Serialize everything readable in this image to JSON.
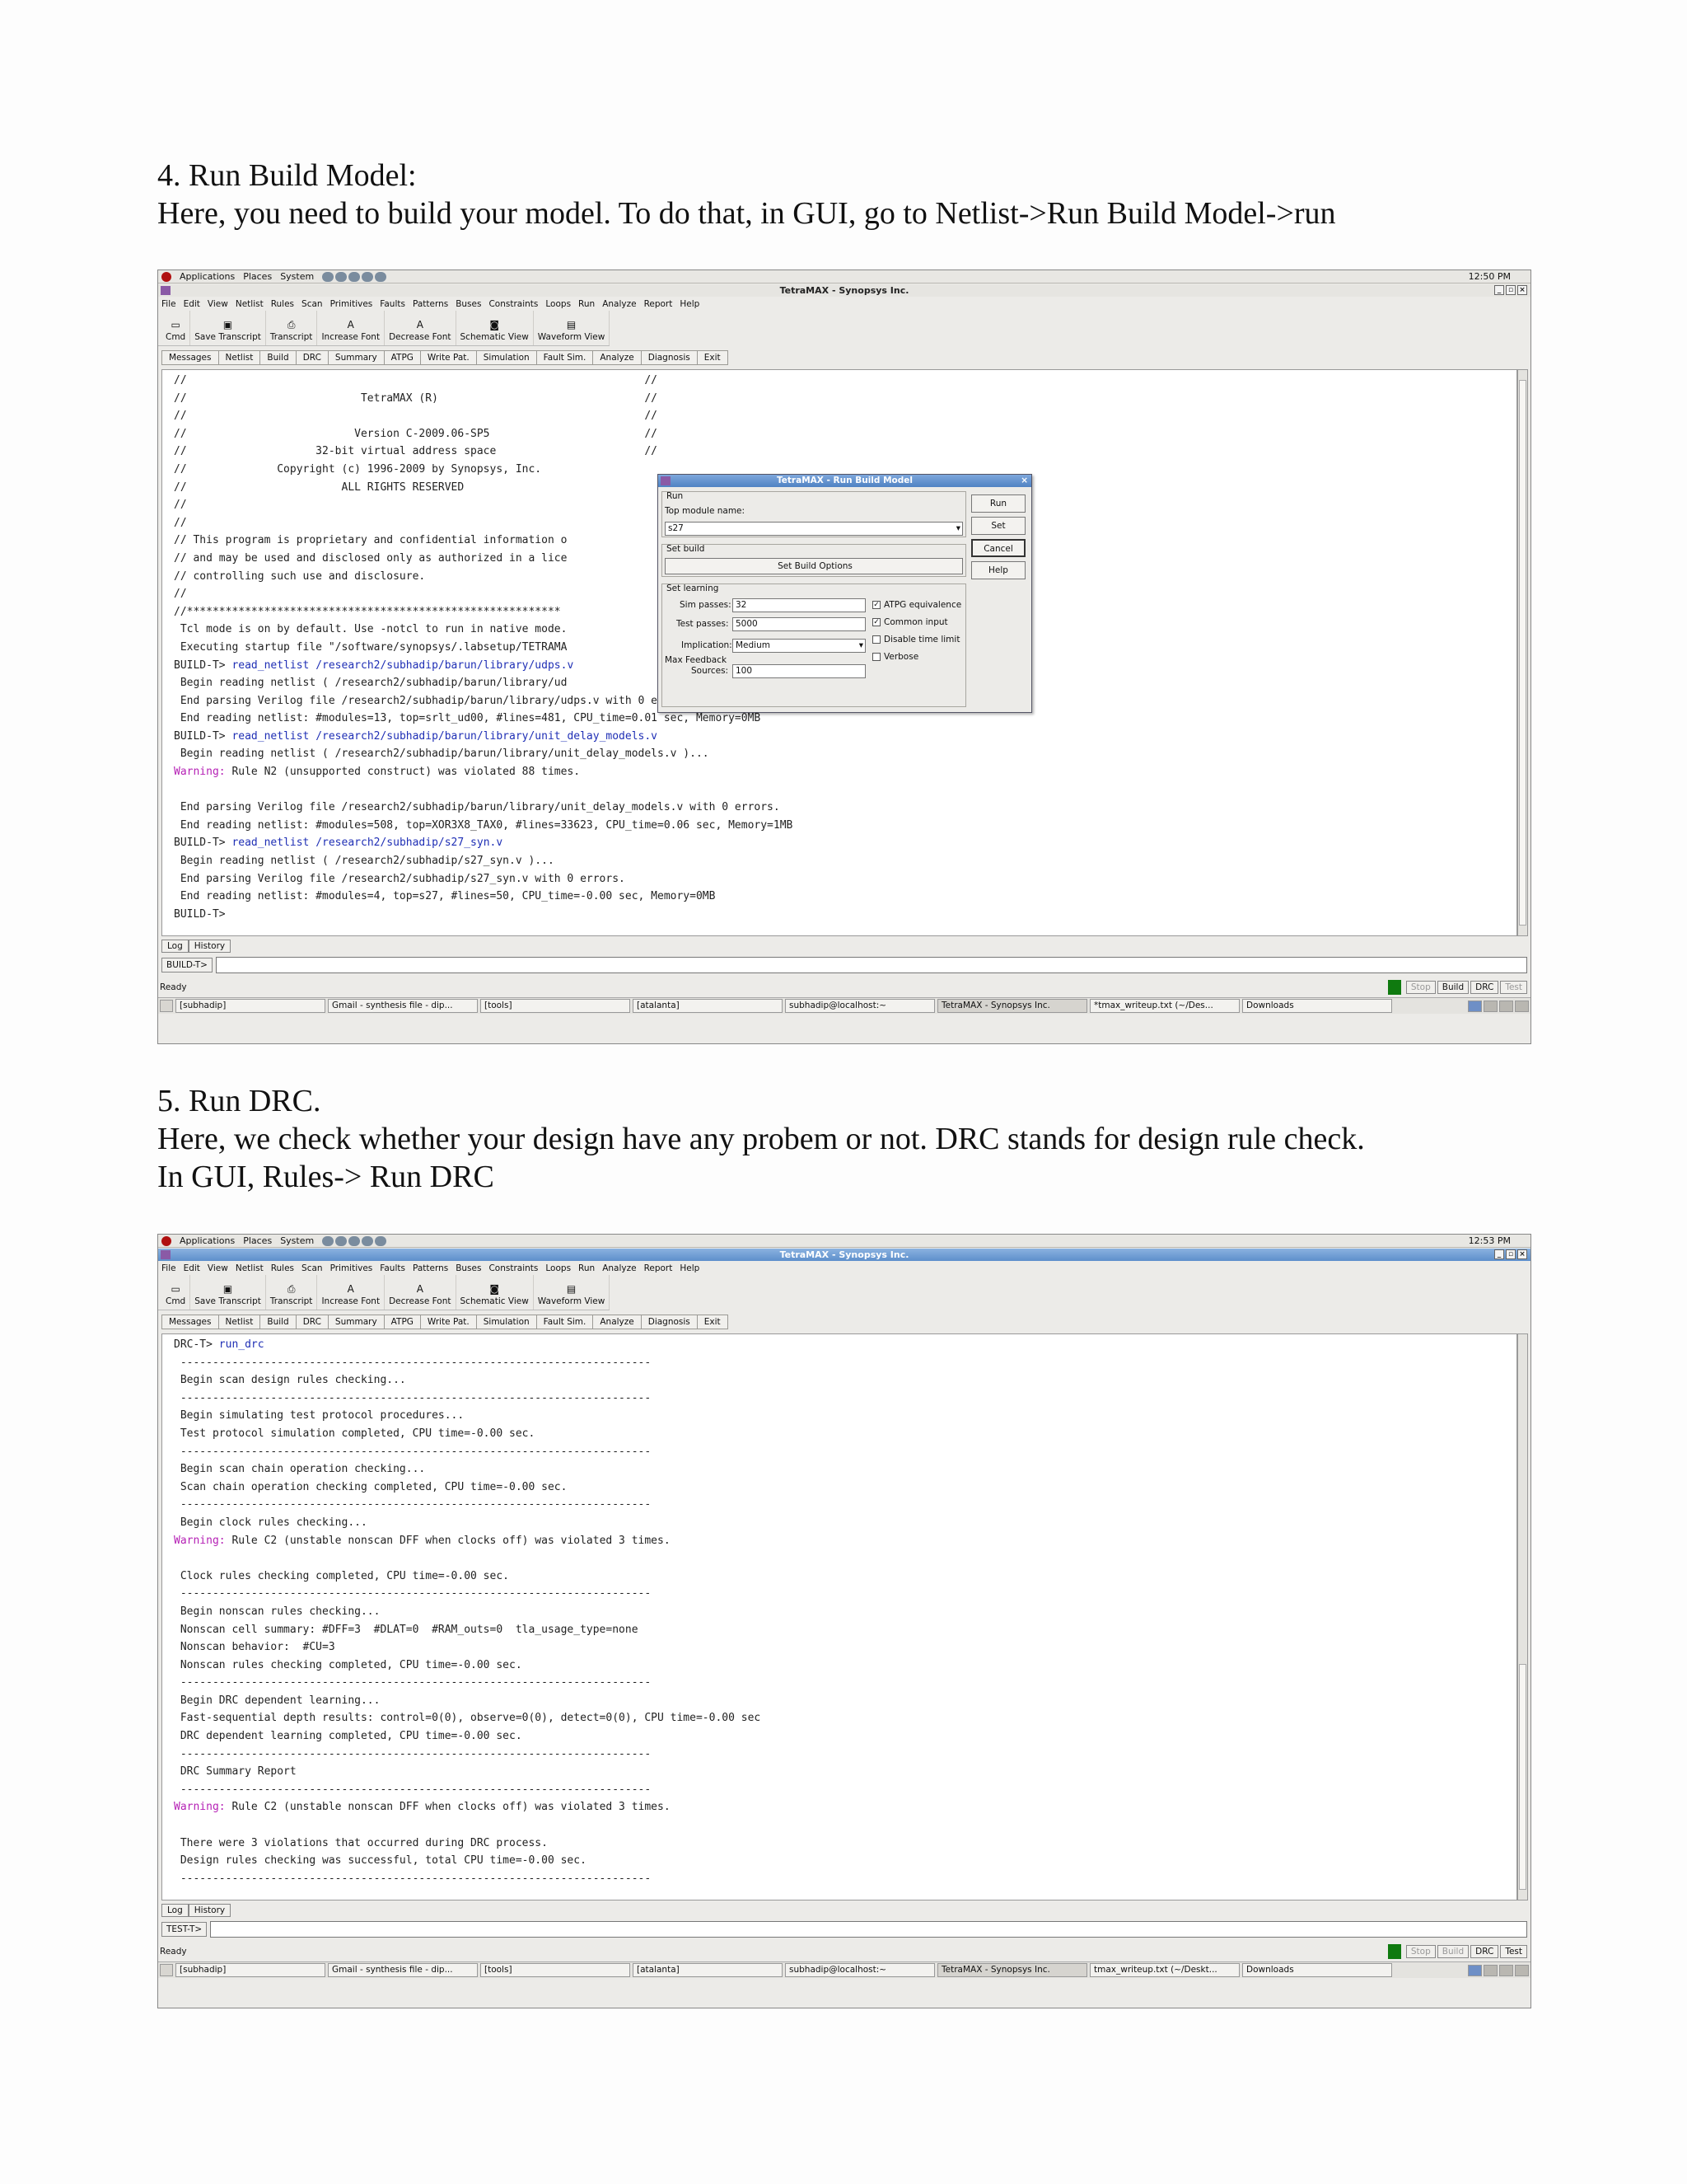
{
  "doc": {
    "step4_title": "4. Run Build Model:",
    "step4_desc": "Here, you need to build your model. To do that, in GUI, go to Netlist->Run Build Model->run",
    "step5_title": "5. Run DRC.",
    "step5_desc": "Here, we check whether your design have any probem or not. DRC stands for design rule check.",
    "step5_desc2": "In GUI, Rules-> Run DRC"
  },
  "desktop": {
    "applications": "Applications",
    "places": "Places",
    "system": "System"
  },
  "app": {
    "window_title": "TetraMAX - Synopsys Inc.",
    "menu": [
      "File",
      "Edit",
      "View",
      "Netlist",
      "Rules",
      "Scan",
      "Primitives",
      "Faults",
      "Patterns",
      "Buses",
      "Constraints",
      "Loops",
      "Run",
      "Analyze",
      "Report",
      "Help"
    ],
    "toolbar": [
      "Cmd",
      "Save Transcript",
      "Transcript",
      "Increase Font",
      "Decrease Font",
      "Schematic View",
      "Waveform View"
    ],
    "tabs": [
      "Messages",
      "Netlist",
      "Build",
      "DRC",
      "Summary",
      "ATPG",
      "Write Pat.",
      "Simulation",
      "Fault Sim.",
      "Analyze",
      "Diagnosis",
      "Exit"
    ],
    "log_tab": "Log",
    "history_tab": "History",
    "status": "Ready",
    "stop": "Stop",
    "build": "Build",
    "drc": "DRC",
    "test": "Test"
  },
  "taskbar": [
    "[subhadip]",
    "Gmail - synthesis file - dip...",
    "[tools]",
    "[atalanta]",
    "subhadip@localhost:~",
    "TetraMAX - Synopsys Inc."
  ],
  "shot1": {
    "clock": "12:50 PM",
    "prompt": "BUILD-T>",
    "task_extra1": "*tmax_writeup.txt (~/Des...",
    "task_extra2": "Downloads",
    "lines": [
      {
        "t": "//                                                                       //"
      },
      {
        "t": "//                           TetraMAX (R)                                //"
      },
      {
        "t": "//                                                                       //"
      },
      {
        "t": "//                          Version C-2009.06-SP5                        //"
      },
      {
        "t": "//                    32-bit virtual address space                       //"
      },
      {
        "t": "//              Copyright (c) 1996-2009 by Synopsys, Inc."
      },
      {
        "t": "//                        ALL RIGHTS RESERVED"
      },
      {
        "t": "//"
      },
      {
        "t": "//"
      },
      {
        "t": "// This program is proprietary and confidential information o"
      },
      {
        "t": "// and may be used and disclosed only as authorized in a lice"
      },
      {
        "t": "// controlling such use and disclosure."
      },
      {
        "t": "//"
      },
      {
        "t": "//**********************************************************"
      },
      {
        "t": " Tcl mode is on by default. Use -notcl to run in native mode."
      },
      {
        "t": " Executing startup file \"/software/synopsys/.labsetup/TETRAMA"
      },
      {
        "p": "BUILD-T> ",
        "c": "read_netlist /research2/subhadip/barun/library/udps.v"
      },
      {
        "t": " Begin reading netlist ( /research2/subhadip/barun/library/ud"
      },
      {
        "t": " End parsing Verilog file /research2/subhadip/barun/library/udps.v with 0 errors."
      },
      {
        "t": " End reading netlist: #modules=13, top=srlt_ud00, #lines=481, CPU_time=0.01 sec, Memory=0MB"
      },
      {
        "p": "BUILD-T> ",
        "c": "read_netlist /research2/subhadip/barun/library/unit_delay_models.v"
      },
      {
        "t": " Begin reading netlist ( /research2/subhadip/barun/library/unit_delay_models.v )..."
      },
      {
        "w": "Warning: ",
        "t2": "Rule N2 (unsupported construct) was violated 88 times."
      },
      {
        "t": ""
      },
      {
        "t": " End parsing Verilog file /research2/subhadip/barun/library/unit_delay_models.v with 0 errors."
      },
      {
        "t": " End reading netlist: #modules=508, top=XOR3X8_TAX0, #lines=33623, CPU_time=0.06 sec, Memory=1MB"
      },
      {
        "p": "BUILD-T> ",
        "c": "read_netlist /research2/subhadip/s27_syn.v"
      },
      {
        "t": " Begin reading netlist ( /research2/subhadip/s27_syn.v )..."
      },
      {
        "t": " End parsing Verilog file /research2/subhadip/s27_syn.v with 0 errors."
      },
      {
        "t": " End reading netlist: #modules=4, top=s27, #lines=50, CPU_time=-0.00 sec, Memory=0MB"
      },
      {
        "p": "BUILD-T>",
        "c": ""
      }
    ]
  },
  "dialog": {
    "title": "TetraMAX - Run Build Model",
    "run_group": "Run",
    "top_module_label": "Top module name:",
    "top_module_value": "s27",
    "set_build_group": "Set build",
    "set_build_options": "Set Build Options",
    "set_learning_group": "Set learning",
    "sim_passes_label": "Sim passes:",
    "sim_passes_value": "32",
    "test_passes_label": "Test passes:",
    "test_passes_value": "5000",
    "implication_label": "Implication:",
    "implication_value": "Medium",
    "max_feedback_label": "Max Feedback",
    "sources_label": "Sources:",
    "sources_value": "100",
    "atpg_equiv": "ATPG equivalence",
    "common_input": "Common input",
    "disable_time": "Disable time limit",
    "verbose": "Verbose",
    "btn_run": "Run",
    "btn_set": "Set",
    "btn_cancel": "Cancel",
    "btn_help": "Help"
  },
  "shot2": {
    "clock": "12:53 PM",
    "prompt": "TEST-T>",
    "task_extra1": "tmax_writeup.txt (~/Deskt...",
    "task_extra2": "Downloads",
    "lines": [
      {
        "p": "DRC-T> ",
        "c": "run_drc"
      },
      {
        "t": " -------------------------------------------------------------------------"
      },
      {
        "t": " Begin scan design rules checking..."
      },
      {
        "t": " -------------------------------------------------------------------------"
      },
      {
        "t": " Begin simulating test protocol procedures..."
      },
      {
        "t": " Test protocol simulation completed, CPU time=-0.00 sec."
      },
      {
        "t": " -------------------------------------------------------------------------"
      },
      {
        "t": " Begin scan chain operation checking..."
      },
      {
        "t": " Scan chain operation checking completed, CPU time=-0.00 sec."
      },
      {
        "t": " -------------------------------------------------------------------------"
      },
      {
        "t": " Begin clock rules checking..."
      },
      {
        "w": "Warning: ",
        "t2": "Rule C2 (unstable nonscan DFF when clocks off) was violated 3 times."
      },
      {
        "t": ""
      },
      {
        "t": " Clock rules checking completed, CPU time=-0.00 sec."
      },
      {
        "t": " -------------------------------------------------------------------------"
      },
      {
        "t": " Begin nonscan rules checking..."
      },
      {
        "t": " Nonscan cell summary: #DFF=3  #DLAT=0  #RAM_outs=0  tla_usage_type=none"
      },
      {
        "t": " Nonscan behavior:  #CU=3"
      },
      {
        "t": " Nonscan rules checking completed, CPU time=-0.00 sec."
      },
      {
        "t": " -------------------------------------------------------------------------"
      },
      {
        "t": " Begin DRC dependent learning..."
      },
      {
        "t": " Fast-sequential depth results: control=0(0), observe=0(0), detect=0(0), CPU time=-0.00 sec"
      },
      {
        "t": " DRC dependent learning completed, CPU time=-0.00 sec."
      },
      {
        "t": " -------------------------------------------------------------------------"
      },
      {
        "t": " DRC Summary Report"
      },
      {
        "t": " -------------------------------------------------------------------------"
      },
      {
        "w": "Warning: ",
        "t2": "Rule C2 (unstable nonscan DFF when clocks off) was violated 3 times."
      },
      {
        "t": ""
      },
      {
        "t": " There were 3 violations that occurred during DRC process."
      },
      {
        "t": " Design rules checking was successful, total CPU time=-0.00 sec."
      },
      {
        "t": " -------------------------------------------------------------------------"
      }
    ]
  }
}
